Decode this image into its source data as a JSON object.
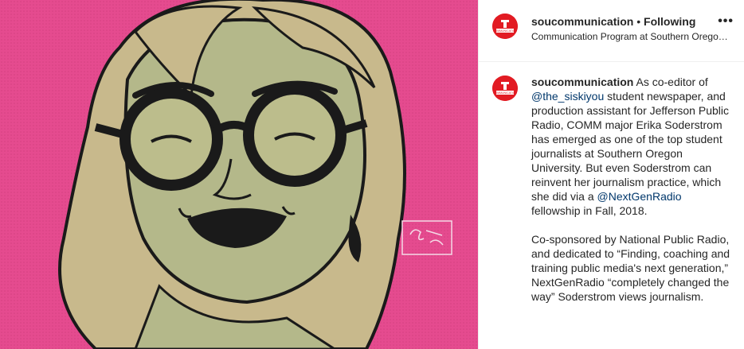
{
  "post": {
    "image_alt": "Illustrated portrait of Erika Soderstrom on a pink background",
    "artist_signature": "Cair Tylenk",
    "colors": {
      "background": "#e54b8f",
      "skin": "#b4b88a",
      "hair": "#c8b98c",
      "outline": "#1a1a1a",
      "brand_red": "#e21b23"
    }
  },
  "header": {
    "username": "soucommunication",
    "separator": " • ",
    "follow_status": "Following",
    "subtitle": "Communication Program at Southern Oregon ...",
    "more_label": "•••",
    "avatar_text": "COMMUNICATION"
  },
  "caption": {
    "username": "soucommunication",
    "p1_a": " As co-editor of ",
    "mention1": "@the_siskiyou",
    "p1_b": " student newspaper, and production assistant for Jefferson Public Radio, COMM major Erika Soderstrom has emerged as one of the top student journalists at Southern Oregon University. But even Soderstrom can reinvent her journalism practice, which she did via a ",
    "mention2": "@NextGenRadio",
    "p1_c": " fellowship in Fall, 2018.",
    "p2": "Co-sponsored by National Public Radio, and dedicated to “Finding, coaching and training public media's next generation,” NextGenRadio “completely changed the way” Soderstrom views journalism."
  }
}
